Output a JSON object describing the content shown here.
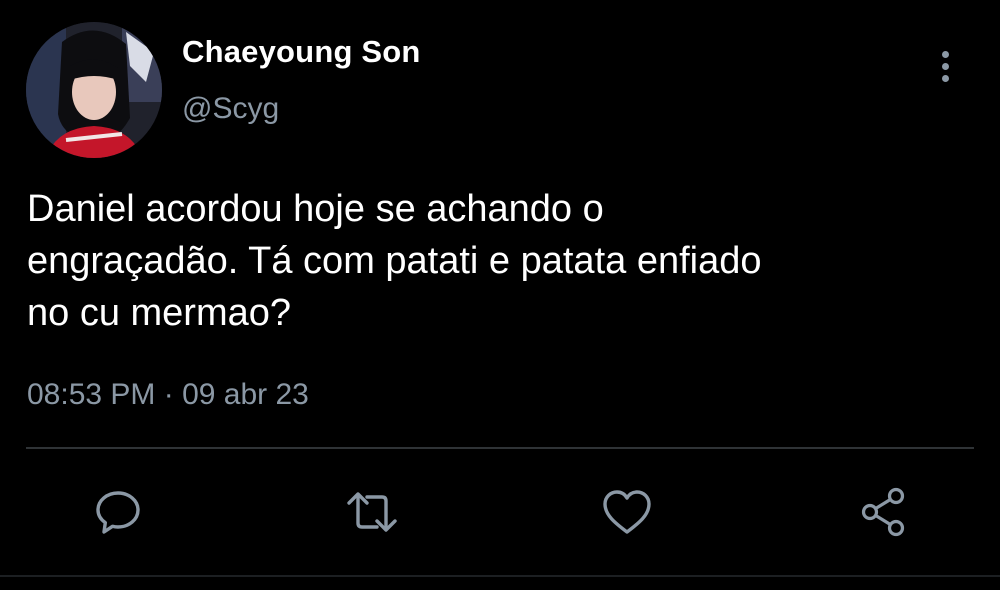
{
  "tweet": {
    "author": {
      "display_name": "Chaeyoung Son",
      "handle": "@Scyg",
      "avatar_icon": "profile-photo"
    },
    "text": "Daniel acordou hoje se achando o\nengraçadão. Tá com patati e patata enfiado\nno cu mermao?",
    "timestamp": "08:53 PM · 09 abr 23",
    "menu_icon": "more-vertical-icon",
    "actions": [
      {
        "icon": "reply-icon"
      },
      {
        "icon": "retweet-icon"
      },
      {
        "icon": "like-icon"
      },
      {
        "icon": "share-icon"
      }
    ]
  },
  "colors": {
    "background": "#000000",
    "primary_text": "#ffffff",
    "secondary_text": "#8b98a5",
    "divider": "#2f3336"
  }
}
